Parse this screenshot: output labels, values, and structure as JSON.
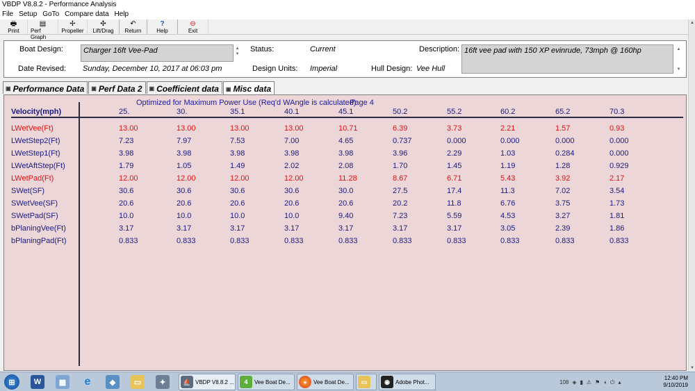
{
  "window": {
    "title": "VBDP V8.8.2 - Performance Analysis"
  },
  "menu": [
    "File",
    "Setup",
    "GoTo",
    "Compare data",
    "Help"
  ],
  "toolbar": [
    {
      "label": "Print",
      "icon": "printer-icon",
      "glyph": "🖶"
    },
    {
      "label": "Perf Graph",
      "icon": "graph-icon",
      "glyph": "▤"
    },
    {
      "label": "Propeller",
      "icon": "propeller-icon",
      "glyph": "✢"
    },
    {
      "label": "Lift/Drag",
      "icon": "lift-drag-icon",
      "glyph": "✣"
    },
    {
      "label": "Return",
      "icon": "return-arrow-icon",
      "glyph": "↶"
    },
    {
      "label": "Help",
      "icon": "help-question-icon",
      "glyph": "?"
    },
    {
      "label": "Exit",
      "icon": "exit-icon",
      "glyph": "⊖"
    }
  ],
  "info": {
    "boat_design_label": "Boat Design:",
    "boat_design_value": "Charger 16ft Vee-Pad",
    "status_label": "Status:",
    "status_value": "Current",
    "description_label": "Description:",
    "description_value": "16ft vee pad with 150 XP evinrude, 73mph @ 160hp",
    "date_revised_label": "Date Revised:",
    "date_revised_value": "Sunday, December 10, 2017 at 06:03 pm",
    "design_units_label": "Design Units:",
    "design_units_value": "Imperial",
    "hull_design_label": "Hull Design:",
    "hull_design_value": "Vee Hull"
  },
  "tabs": [
    "Performance Data",
    "Perf Data 2",
    "Coefficient data",
    "Misc data"
  ],
  "active_tab": 3,
  "table": {
    "subtitle": "Optimized for Maximum Power Use (Req'd WAngle is calculated)",
    "page_label": "Page 4",
    "header_label": "Velocity(mph)",
    "velocities": [
      "25.",
      "30.",
      "35.1",
      "40.1",
      "45.1",
      "50.2",
      "55.2",
      "60.2",
      "65.2",
      "70.3"
    ],
    "rows": [
      {
        "label": "LWetVee(Ft)",
        "highlight": true,
        "values": [
          "13.00",
          "13.00",
          "13.00",
          "13.00",
          "10.71",
          "6.39",
          "3.73",
          "2.21",
          "1.57",
          "0.93"
        ]
      },
      {
        "label": "LWetStep2(Ft)",
        "highlight": false,
        "values": [
          "7.23",
          "7.97",
          "7.53",
          "7.00",
          "4.65",
          "0.737",
          "0.000",
          "0.000",
          "0.000",
          "0.000"
        ]
      },
      {
        "label": "LWetStep1(Ft)",
        "highlight": false,
        "values": [
          "3.98",
          "3.98",
          "3.98",
          "3.98",
          "3.98",
          "3.96",
          "2.29",
          "1.03",
          "0.284",
          "0.000"
        ]
      },
      {
        "label": "LWetAftStep(Ft)",
        "highlight": false,
        "values": [
          "1.79",
          "1.05",
          "1.49",
          "2.02",
          "2.08",
          "1.70",
          "1.45",
          "1.19",
          "1.28",
          "0.929"
        ]
      },
      {
        "label": "LWetPad(Ft)",
        "highlight": true,
        "values": [
          "12.00",
          "12.00",
          "12.00",
          "12.00",
          "11.28",
          "8.67",
          "6.71",
          "5.43",
          "3.92",
          "2.17"
        ]
      },
      {
        "label": "SWet(SF)",
        "highlight": false,
        "values": [
          "30.6",
          "30.6",
          "30.6",
          "30.6",
          "30.0",
          "27.5",
          "17.4",
          "11.3",
          "7.02",
          "3.54"
        ]
      },
      {
        "label": "SWetVee(SF)",
        "highlight": false,
        "values": [
          "20.6",
          "20.6",
          "20.6",
          "20.6",
          "20.6",
          "20.2",
          "11.8",
          "6.76",
          "3.75",
          "1.73"
        ]
      },
      {
        "label": "SWetPad(SF)",
        "highlight": false,
        "values": [
          "10.0",
          "10.0",
          "10.0",
          "10.0",
          "9.40",
          "7.23",
          "5.59",
          "4.53",
          "3.27",
          "1.81"
        ]
      },
      {
        "label": "bPlaningVee(Ft)",
        "highlight": false,
        "values": [
          "3.17",
          "3.17",
          "3.17",
          "3.17",
          "3.17",
          "3.17",
          "3.17",
          "3.05",
          "2.39",
          "1.86"
        ]
      },
      {
        "label": "bPlaningPad(Ft)",
        "highlight": false,
        "values": [
          "0.833",
          "0.833",
          "0.833",
          "0.833",
          "0.833",
          "0.833",
          "0.833",
          "0.833",
          "0.833",
          "0.833"
        ]
      }
    ]
  },
  "taskbar": {
    "tasks": [
      {
        "label": "VBDP V8.8.2 ...",
        "icon": "vbdp-icon",
        "active": true
      },
      {
        "label": "Vee Boat De...",
        "icon": "excel-icon",
        "active": false
      },
      {
        "label": "Vee Boat De...",
        "icon": "firefox-icon",
        "active": false
      },
      {
        "label": "",
        "icon": "folder-icon",
        "active": false
      },
      {
        "label": "Adobe Phot...",
        "icon": "photoshop-icon",
        "active": false
      }
    ],
    "clock_time": "12:40 PM",
    "clock_date": "9/10/2019",
    "tray_text": "108"
  },
  "colors": {
    "panel_bg": "#ecd6d8",
    "text_blue": "#1a1a80",
    "text_red": "#e01010",
    "taskbar_bg": "#b9c9da"
  }
}
